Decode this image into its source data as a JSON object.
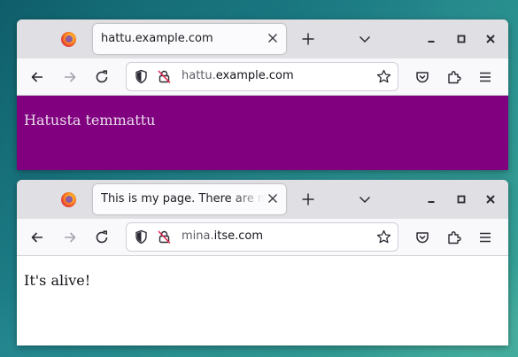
{
  "windows": [
    {
      "tab_title": "hattu.example.com",
      "url_prefix": "hattu.",
      "url_host": "example.com",
      "page_text": "Hatusta temmattu",
      "page_bg": "#800080",
      "page_text_color": "#e9dde9"
    },
    {
      "tab_title": "This is my page. There are many like it",
      "url_prefix": "mina.",
      "url_host": "itse.com",
      "page_text": "It's alive!",
      "page_bg": "#ffffff",
      "page_text_color": "#15141a"
    }
  ],
  "icons": {
    "logo": "firefox-logo-icon",
    "tab_close": "close-icon",
    "new_tab": "plus-icon",
    "list_tabs": "chevron-down-icon",
    "minimize": "minimize-icon",
    "maximize": "maximize-icon",
    "close_window": "close-icon",
    "back": "arrow-left-icon",
    "forward": "arrow-right-icon",
    "reload": "reload-icon",
    "tracking": "shield-icon",
    "insecure": "lock-slash-icon",
    "bookmark": "star-icon",
    "pocket": "pocket-icon",
    "extensions": "puzzle-icon",
    "menu": "hamburger-icon"
  }
}
